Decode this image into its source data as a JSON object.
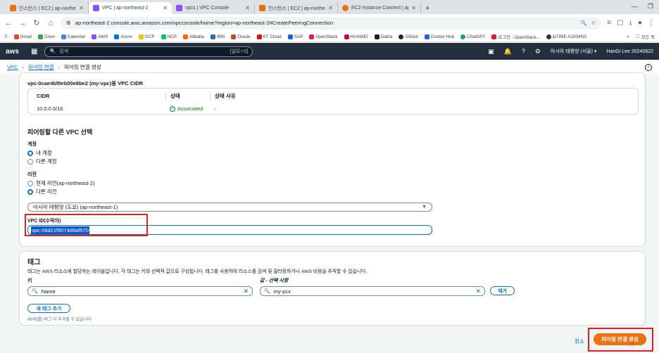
{
  "browser": {
    "tabs": [
      {
        "title": "인스턴스 | EC2 | ap-northeast-",
        "color": "#e8710a"
      },
      {
        "title": "VPC | ap-northeast-2",
        "color": "#8c4fff"
      },
      {
        "title": "vpcs | VPC Console",
        "color": "#8c4fff"
      },
      {
        "title": "인스턴스 | EC2 | ap-northeast-",
        "color": "#e8710a"
      },
      {
        "title": "EC2 Instance Connect | ap-nor",
        "color": "#e8710a"
      }
    ],
    "url": "ap-northeast-2.console.aws.amazon.com/vpcconsole/home?region=ap-northeast-2#CreatePeeringConnection:",
    "bookmarks": [
      "Gmail",
      "Drive",
      "Calendar",
      "AWS",
      "Azure",
      "GCP",
      "NCP",
      "Alibaba",
      "IBM",
      "Oracle",
      "KT Cloud",
      "SAP",
      "OpenStack",
      "HUAWEI",
      "Gabia",
      "Github",
      "Docker Hub",
      "ChatGPT",
      "로그인 - OpenStack...",
      "ipTIME A1004NS"
    ],
    "bookmarks_folder": "모든 북"
  },
  "aws": {
    "logo": "aws",
    "search_placeholder": "검색",
    "search_shortcut": "[알트+S]",
    "region": "아시아 태평양 (서울) ▾",
    "account": "HanGi Lee 20240622"
  },
  "breadcrumb": [
    "VPC",
    "피어링 연결",
    "피어링 연결 생성"
  ],
  "cidr": {
    "title": "vpc-0cae4bf0eb00e8be2 (my-vpc)용 VPC CIDR",
    "headers": [
      "CIDR",
      "상태",
      "상태 사유"
    ],
    "row": {
      "cidr": "10.0.0.0/16",
      "state": "Associated",
      "reason": "-"
    }
  },
  "peer": {
    "title": "피어링할 다른 VPC 선택",
    "account_label": "계정",
    "account_options": [
      "내 계정",
      "다른 계정"
    ],
    "region_label": "리전",
    "region_options": [
      "현재 리전(ap-northeast-2)",
      "다른 리전"
    ],
    "region_select": "아시아 태평양 (도쿄) (ap-northeast-1)",
    "vpcid_label": "VPC ID(수락자)",
    "vpcid_value": "vpc-08d21f9074d8af570"
  },
  "tags": {
    "title": "태그",
    "description": "태그는 AWS 리소스에 할당하는 레이블입니다. 각 태그는 키와 선택적 값으로 구성됩니다. 태그를 사용하여 리소스를 검색 및 필터링하거나 AWS 비용을 추적할 수 있습니다.",
    "key_label": "키",
    "value_label": "값 - 선택 사항",
    "key_value": "Name",
    "value_value": "my-pcx",
    "remove_label": "제거",
    "add_label": "새 태그 추가",
    "hint": "49개(를) 태그 더 추가할 수 있습니다."
  },
  "actions": {
    "cancel": "취소",
    "create": "피어링 연결 생성"
  }
}
